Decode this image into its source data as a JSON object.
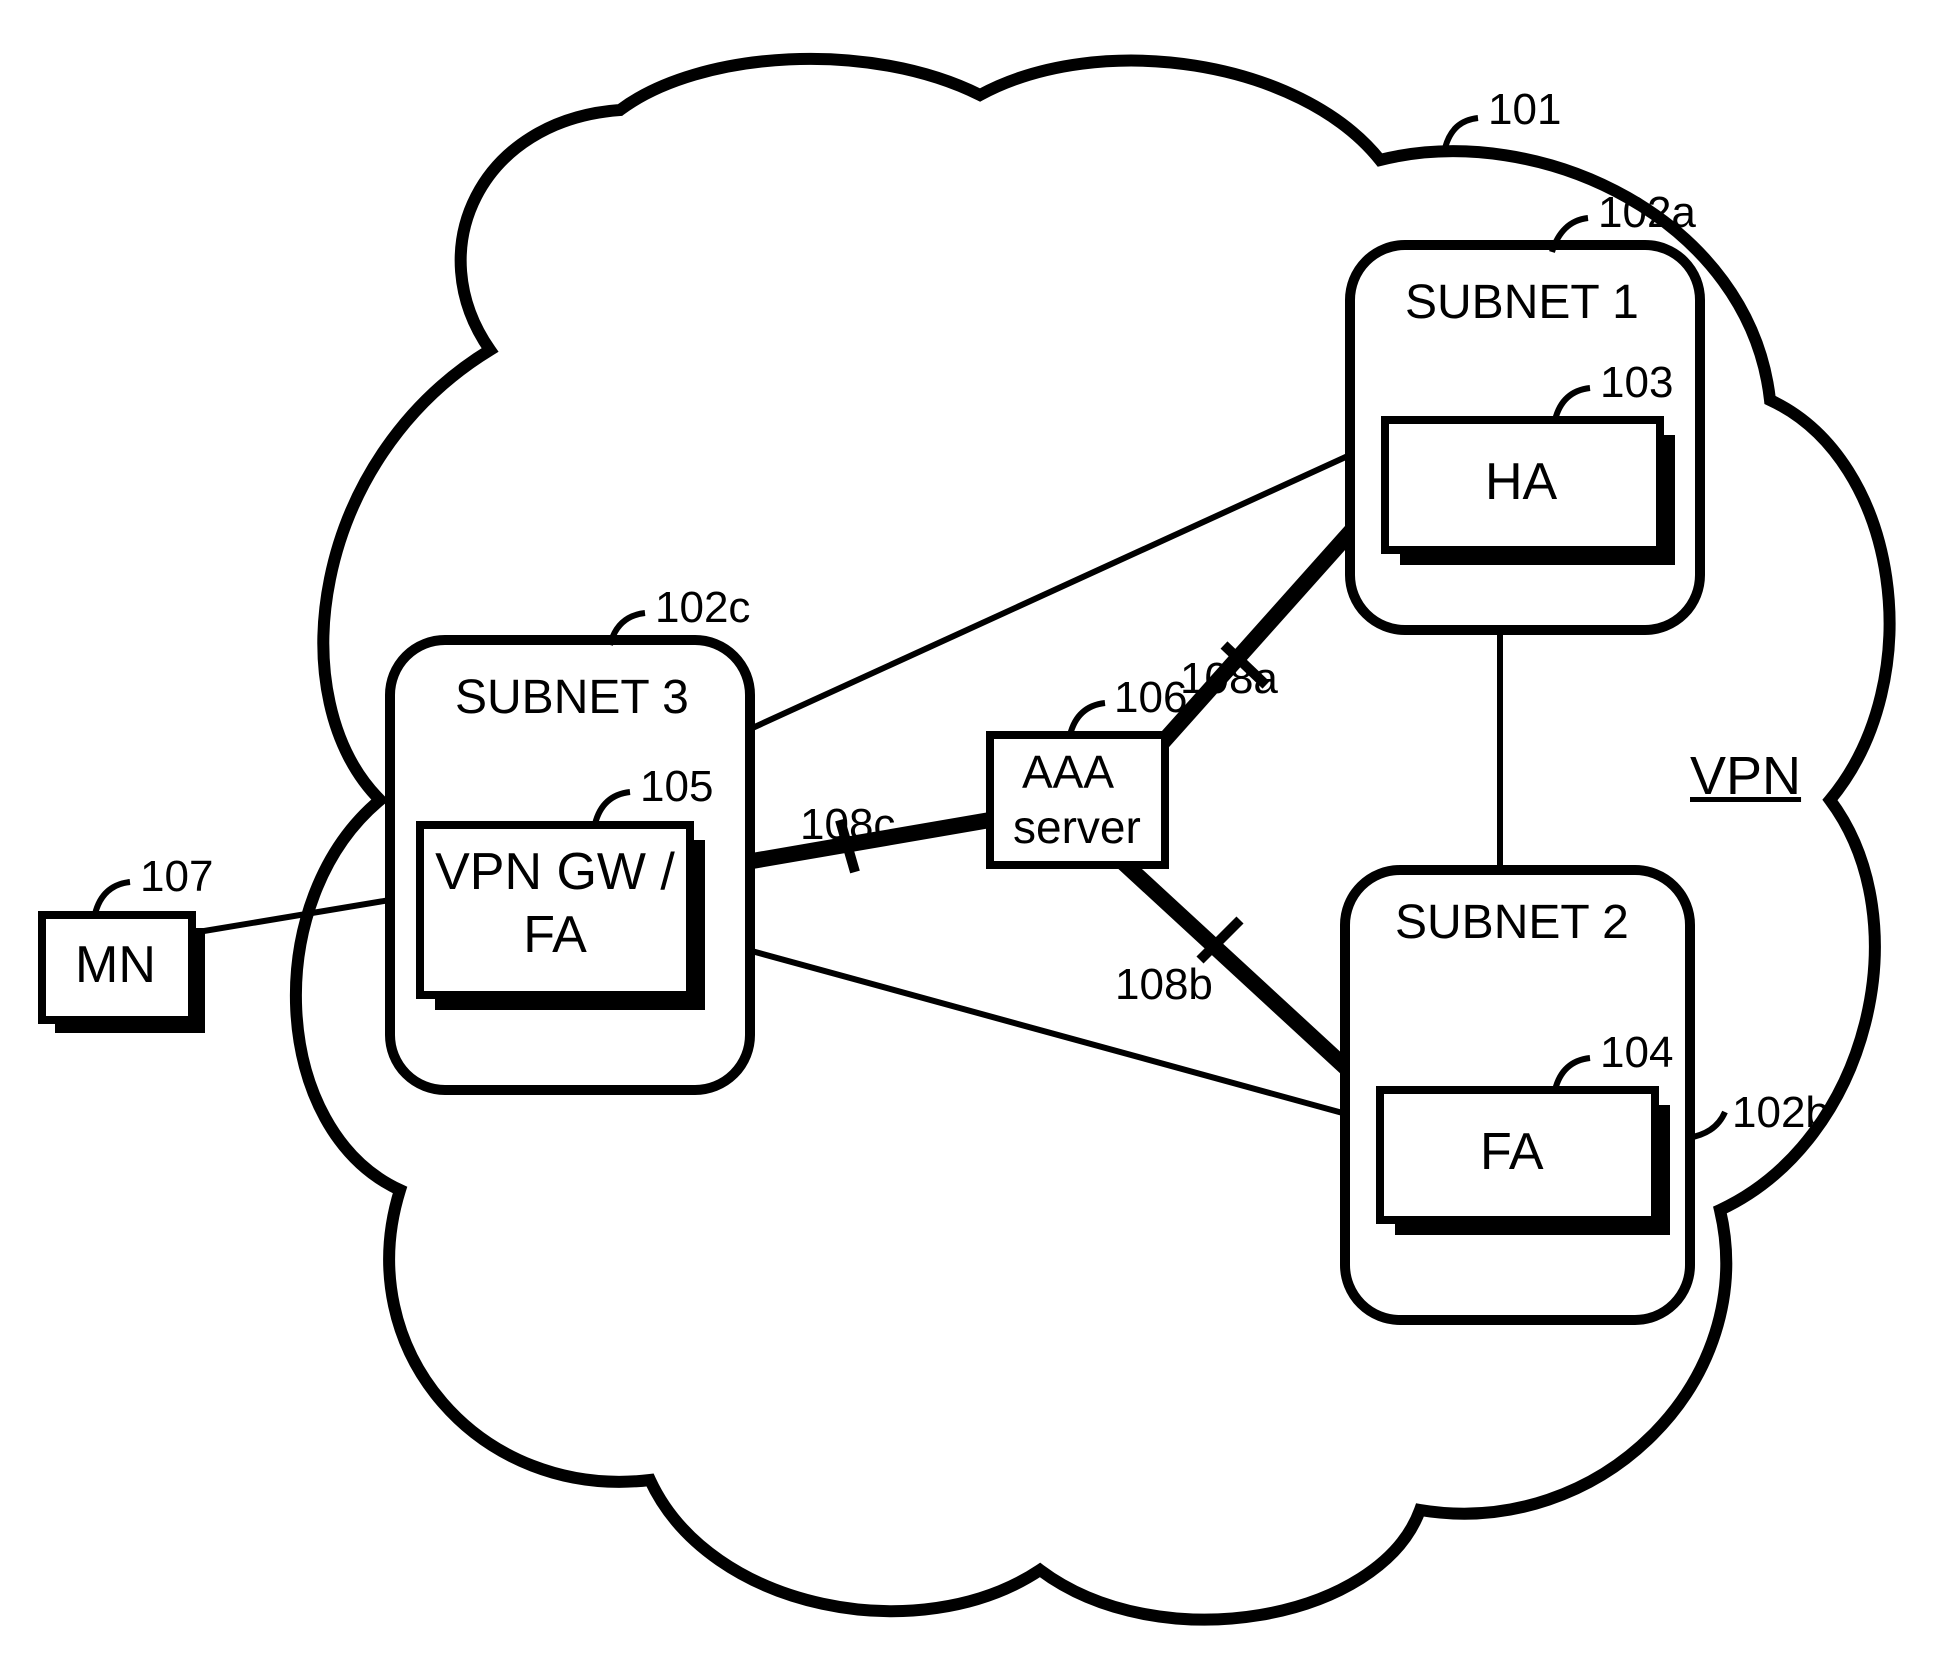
{
  "diagram": {
    "cloud_ref": "101",
    "vpn_label": "VPN",
    "subnet1": {
      "title": "SUBNET 1",
      "ref": "102a",
      "box_ref": "103",
      "box_label": "HA"
    },
    "subnet2": {
      "title": "SUBNET 2",
      "ref": "102b",
      "box_ref": "104",
      "box_label": "FA"
    },
    "subnet3": {
      "title": "SUBNET 3",
      "ref": "102c",
      "box_ref": "105",
      "box_label_line1": "VPN GW /",
      "box_label_line2": "FA"
    },
    "aaa": {
      "ref": "106",
      "label_line1": "AAA",
      "label_line2": "server"
    },
    "mn": {
      "ref": "107",
      "label": "MN"
    },
    "link_refs": {
      "a": "108a",
      "b": "108b",
      "c": "108c"
    }
  }
}
